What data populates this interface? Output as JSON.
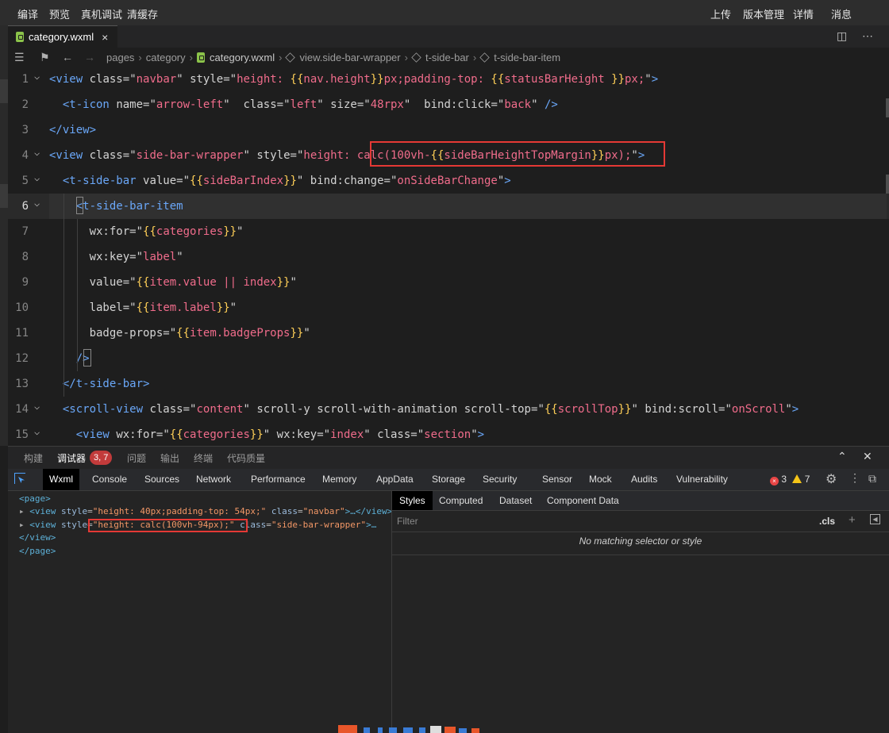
{
  "toolbar": {
    "left": [
      "编译",
      "预览",
      "真机调试",
      "清缓存"
    ],
    "right": [
      "上传",
      "版本管理",
      "详情",
      "消息"
    ]
  },
  "tab": {
    "filename": "category.wxml",
    "close": "×"
  },
  "breadcrumb": {
    "items": [
      "pages",
      "category",
      "category.wxml",
      "view.side-bar-wrapper",
      "t-side-bar",
      "t-side-bar-item"
    ]
  },
  "editor": {
    "active_line": 6,
    "lines": [
      {
        "n": "1",
        "text": "<view class=\"navbar\" style=\"height: {{nav.height}}px;padding-top: {{statusBarHeight }}px;\">"
      },
      {
        "n": "2",
        "text": "<t-icon name=\"arrow-left\"  class=\"left\" size=\"48rpx\"  bind:click=\"back\" />"
      },
      {
        "n": "3",
        "text": "</view>"
      },
      {
        "n": "4",
        "text": "<view class=\"side-bar-wrapper\" style=\"height: calc(100vh-{{sideBarHeightTopMargin}}px);\">"
      },
      {
        "n": "5",
        "text": "<t-side-bar value=\"{{sideBarIndex}}\" bind:change=\"onSideBarChange\">"
      },
      {
        "n": "6",
        "text": "<t-side-bar-item"
      },
      {
        "n": "7",
        "text": "wx:for=\"{{categories}}\""
      },
      {
        "n": "8",
        "text": "wx:key=\"label\""
      },
      {
        "n": "9",
        "text": "value=\"{{item.value || index}}\""
      },
      {
        "n": "10",
        "text": "label=\"{{item.label}}\""
      },
      {
        "n": "11",
        "text": "badge-props=\"{{item.badgeProps}}\""
      },
      {
        "n": "12",
        "text": "/>"
      },
      {
        "n": "13",
        "text": "</t-side-bar>"
      },
      {
        "n": "14",
        "text": "<scroll-view class=\"content\" scroll-y scroll-with-animation scroll-top=\"{{scrollTop}}\" bind:scroll=\"onScroll\">"
      },
      {
        "n": "15",
        "text": "<view wx:for=\"{{categories}}\" wx:key=\"index\" class=\"section\">"
      }
    ]
  },
  "panel": {
    "tabs": [
      "构建",
      "调试器",
      "问题",
      "输出",
      "终端",
      "代码质量"
    ],
    "active_tab": "调试器",
    "debugger_badge": "3, 7"
  },
  "devtools": {
    "tabs": [
      "Wxml",
      "Console",
      "Sources",
      "Network",
      "Performance",
      "Memory",
      "AppData",
      "Storage",
      "Security",
      "Sensor",
      "Mock",
      "Audits",
      "Vulnerability"
    ],
    "active_tab": "Wxml",
    "errors": "3",
    "warnings": "7"
  },
  "wxml_tree": {
    "page_open": "<page>",
    "row1": {
      "attr1_name": "style",
      "attr1_value": "\"height: 40px;padding-top: 54px;\"",
      "attr2_name": "class",
      "attr2_value": "\"navbar\"",
      "tail": ">…</view>"
    },
    "row2": {
      "attr1_name": "style",
      "attr1_value": "\"height: calc(100vh-94px);\"",
      "attr2_name": "class",
      "attr2_value": "\"side-bar-wrapper\"",
      "tail": ">…"
    },
    "view_close": "</view>",
    "page_close": "</page>"
  },
  "styles": {
    "tabs": [
      "Styles",
      "Computed",
      "Dataset",
      "Component Data"
    ],
    "active_tab": "Styles",
    "filter_placeholder": "Filter",
    "cls_label": ".cls",
    "empty_message": "No matching selector or style"
  },
  "colors": {
    "tag": "#6aa7f8",
    "string": "#f06c8b",
    "mustache": "#ffcf57",
    "highlight": "#e53935"
  }
}
